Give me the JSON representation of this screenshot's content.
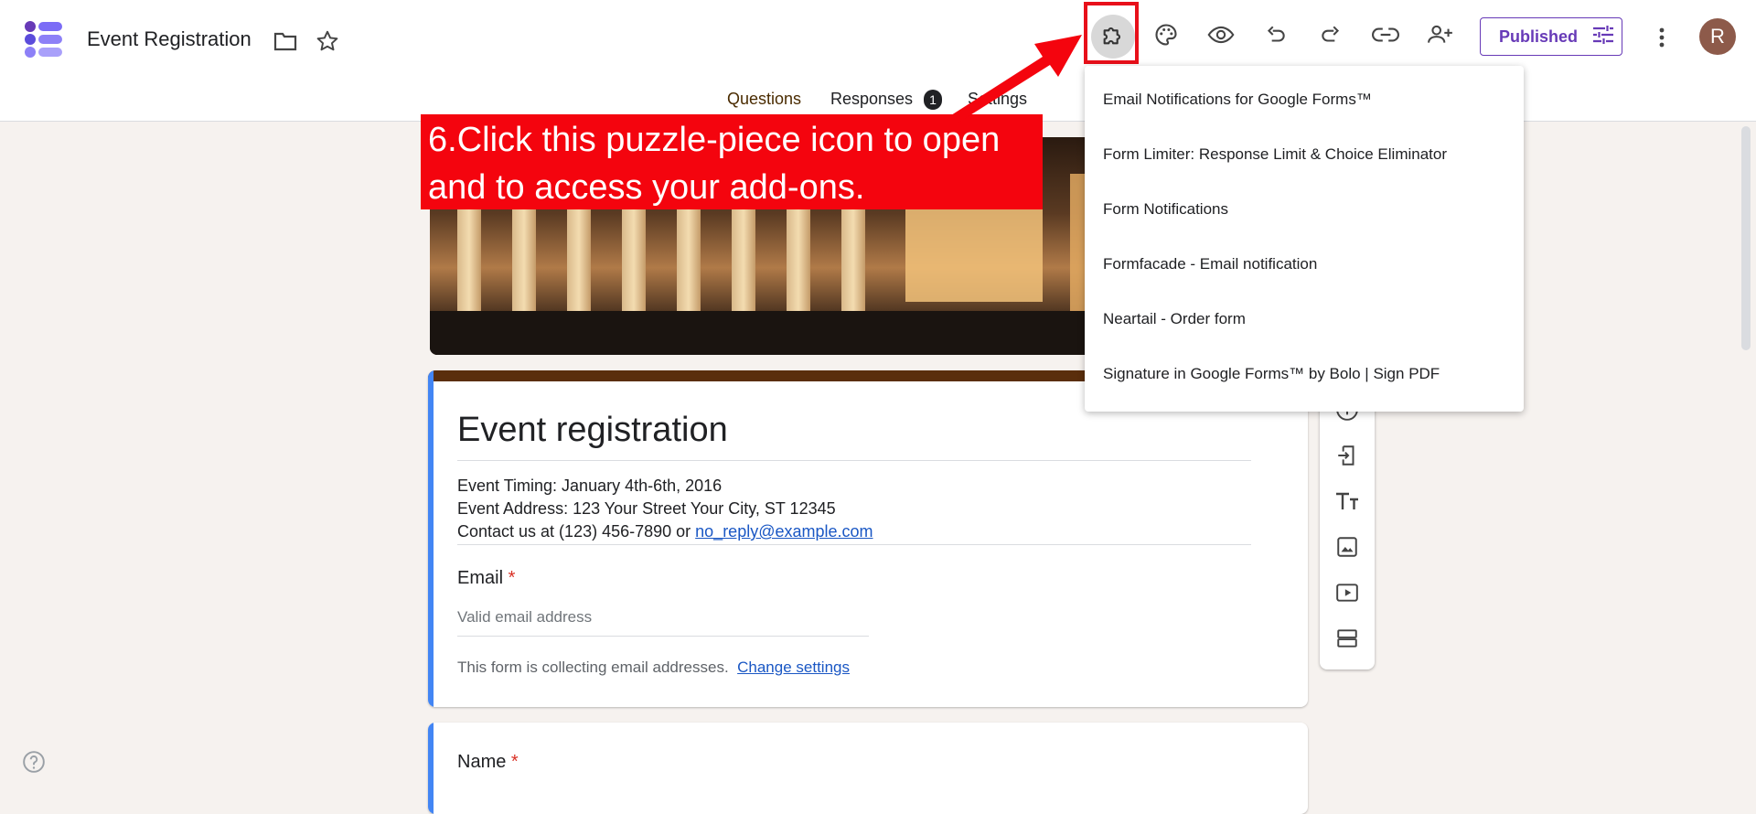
{
  "header": {
    "title": "Event Registration",
    "published_label": "Published",
    "avatar_letter": "R"
  },
  "tabs": {
    "questions": "Questions",
    "responses": "Responses",
    "responses_badge": "1",
    "settings": "Settings"
  },
  "addons_menu": {
    "items": [
      "Email Notifications for Google Forms™",
      "Form Limiter: Response Limit & Choice Eliminator",
      "Form Notifications",
      "Formfacade - Email notification",
      "Neartail - Order form",
      "Signature in Google Forms™ by Bolo | Sign PDF"
    ]
  },
  "callout": {
    "line1": "6.Click this puzzle-piece icon to open",
    "line2": "and to access your add-ons."
  },
  "form": {
    "title": "Event registration",
    "timing": "Event Timing: January 4th-6th, 2016",
    "address": "Event Address: 123 Your Street Your City, ST 12345",
    "contact_prefix": "Contact us at (123) 456-7890 or ",
    "contact_email": "no_reply@example.com",
    "email_label": "Email",
    "email_placeholder": "Valid email address",
    "collect_note": "This form is collecting email addresses.",
    "change_settings": "Change settings",
    "name_label": "Name",
    "required_mark": "*"
  },
  "colors": {
    "accent": "#673ab7",
    "callout_red": "#f4040e",
    "link_blue": "#1a57c4",
    "card_left": "#4285f4"
  }
}
